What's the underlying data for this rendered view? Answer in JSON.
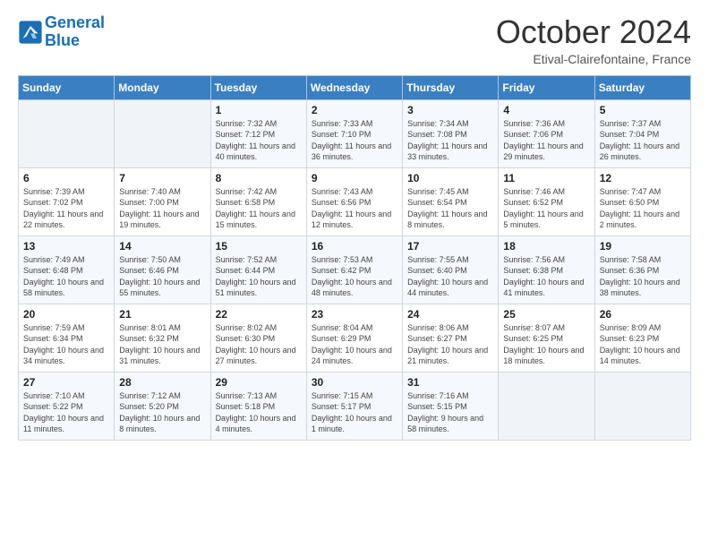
{
  "header": {
    "logo_line1": "General",
    "logo_line2": "Blue",
    "month": "October 2024",
    "location": "Etival-Clairefontaine, France"
  },
  "days_of_week": [
    "Sunday",
    "Monday",
    "Tuesday",
    "Wednesday",
    "Thursday",
    "Friday",
    "Saturday"
  ],
  "weeks": [
    [
      {
        "day": "",
        "sunrise": "",
        "sunset": "",
        "daylight": ""
      },
      {
        "day": "",
        "sunrise": "",
        "sunset": "",
        "daylight": ""
      },
      {
        "day": "1",
        "sunrise": "Sunrise: 7:32 AM",
        "sunset": "Sunset: 7:12 PM",
        "daylight": "Daylight: 11 hours and 40 minutes."
      },
      {
        "day": "2",
        "sunrise": "Sunrise: 7:33 AM",
        "sunset": "Sunset: 7:10 PM",
        "daylight": "Daylight: 11 hours and 36 minutes."
      },
      {
        "day": "3",
        "sunrise": "Sunrise: 7:34 AM",
        "sunset": "Sunset: 7:08 PM",
        "daylight": "Daylight: 11 hours and 33 minutes."
      },
      {
        "day": "4",
        "sunrise": "Sunrise: 7:36 AM",
        "sunset": "Sunset: 7:06 PM",
        "daylight": "Daylight: 11 hours and 29 minutes."
      },
      {
        "day": "5",
        "sunrise": "Sunrise: 7:37 AM",
        "sunset": "Sunset: 7:04 PM",
        "daylight": "Daylight: 11 hours and 26 minutes."
      }
    ],
    [
      {
        "day": "6",
        "sunrise": "Sunrise: 7:39 AM",
        "sunset": "Sunset: 7:02 PM",
        "daylight": "Daylight: 11 hours and 22 minutes."
      },
      {
        "day": "7",
        "sunrise": "Sunrise: 7:40 AM",
        "sunset": "Sunset: 7:00 PM",
        "daylight": "Daylight: 11 hours and 19 minutes."
      },
      {
        "day": "8",
        "sunrise": "Sunrise: 7:42 AM",
        "sunset": "Sunset: 6:58 PM",
        "daylight": "Daylight: 11 hours and 15 minutes."
      },
      {
        "day": "9",
        "sunrise": "Sunrise: 7:43 AM",
        "sunset": "Sunset: 6:56 PM",
        "daylight": "Daylight: 11 hours and 12 minutes."
      },
      {
        "day": "10",
        "sunrise": "Sunrise: 7:45 AM",
        "sunset": "Sunset: 6:54 PM",
        "daylight": "Daylight: 11 hours and 8 minutes."
      },
      {
        "day": "11",
        "sunrise": "Sunrise: 7:46 AM",
        "sunset": "Sunset: 6:52 PM",
        "daylight": "Daylight: 11 hours and 5 minutes."
      },
      {
        "day": "12",
        "sunrise": "Sunrise: 7:47 AM",
        "sunset": "Sunset: 6:50 PM",
        "daylight": "Daylight: 11 hours and 2 minutes."
      }
    ],
    [
      {
        "day": "13",
        "sunrise": "Sunrise: 7:49 AM",
        "sunset": "Sunset: 6:48 PM",
        "daylight": "Daylight: 10 hours and 58 minutes."
      },
      {
        "day": "14",
        "sunrise": "Sunrise: 7:50 AM",
        "sunset": "Sunset: 6:46 PM",
        "daylight": "Daylight: 10 hours and 55 minutes."
      },
      {
        "day": "15",
        "sunrise": "Sunrise: 7:52 AM",
        "sunset": "Sunset: 6:44 PM",
        "daylight": "Daylight: 10 hours and 51 minutes."
      },
      {
        "day": "16",
        "sunrise": "Sunrise: 7:53 AM",
        "sunset": "Sunset: 6:42 PM",
        "daylight": "Daylight: 10 hours and 48 minutes."
      },
      {
        "day": "17",
        "sunrise": "Sunrise: 7:55 AM",
        "sunset": "Sunset: 6:40 PM",
        "daylight": "Daylight: 10 hours and 44 minutes."
      },
      {
        "day": "18",
        "sunrise": "Sunrise: 7:56 AM",
        "sunset": "Sunset: 6:38 PM",
        "daylight": "Daylight: 10 hours and 41 minutes."
      },
      {
        "day": "19",
        "sunrise": "Sunrise: 7:58 AM",
        "sunset": "Sunset: 6:36 PM",
        "daylight": "Daylight: 10 hours and 38 minutes."
      }
    ],
    [
      {
        "day": "20",
        "sunrise": "Sunrise: 7:59 AM",
        "sunset": "Sunset: 6:34 PM",
        "daylight": "Daylight: 10 hours and 34 minutes."
      },
      {
        "day": "21",
        "sunrise": "Sunrise: 8:01 AM",
        "sunset": "Sunset: 6:32 PM",
        "daylight": "Daylight: 10 hours and 31 minutes."
      },
      {
        "day": "22",
        "sunrise": "Sunrise: 8:02 AM",
        "sunset": "Sunset: 6:30 PM",
        "daylight": "Daylight: 10 hours and 27 minutes."
      },
      {
        "day": "23",
        "sunrise": "Sunrise: 8:04 AM",
        "sunset": "Sunset: 6:29 PM",
        "daylight": "Daylight: 10 hours and 24 minutes."
      },
      {
        "day": "24",
        "sunrise": "Sunrise: 8:06 AM",
        "sunset": "Sunset: 6:27 PM",
        "daylight": "Daylight: 10 hours and 21 minutes."
      },
      {
        "day": "25",
        "sunrise": "Sunrise: 8:07 AM",
        "sunset": "Sunset: 6:25 PM",
        "daylight": "Daylight: 10 hours and 18 minutes."
      },
      {
        "day": "26",
        "sunrise": "Sunrise: 8:09 AM",
        "sunset": "Sunset: 6:23 PM",
        "daylight": "Daylight: 10 hours and 14 minutes."
      }
    ],
    [
      {
        "day": "27",
        "sunrise": "Sunrise: 7:10 AM",
        "sunset": "Sunset: 5:22 PM",
        "daylight": "Daylight: 10 hours and 11 minutes."
      },
      {
        "day": "28",
        "sunrise": "Sunrise: 7:12 AM",
        "sunset": "Sunset: 5:20 PM",
        "daylight": "Daylight: 10 hours and 8 minutes."
      },
      {
        "day": "29",
        "sunrise": "Sunrise: 7:13 AM",
        "sunset": "Sunset: 5:18 PM",
        "daylight": "Daylight: 10 hours and 4 minutes."
      },
      {
        "day": "30",
        "sunrise": "Sunrise: 7:15 AM",
        "sunset": "Sunset: 5:17 PM",
        "daylight": "Daylight: 10 hours and 1 minute."
      },
      {
        "day": "31",
        "sunrise": "Sunrise: 7:16 AM",
        "sunset": "Sunset: 5:15 PM",
        "daylight": "Daylight: 9 hours and 58 minutes."
      },
      {
        "day": "",
        "sunrise": "",
        "sunset": "",
        "daylight": ""
      },
      {
        "day": "",
        "sunrise": "",
        "sunset": "",
        "daylight": ""
      }
    ]
  ]
}
